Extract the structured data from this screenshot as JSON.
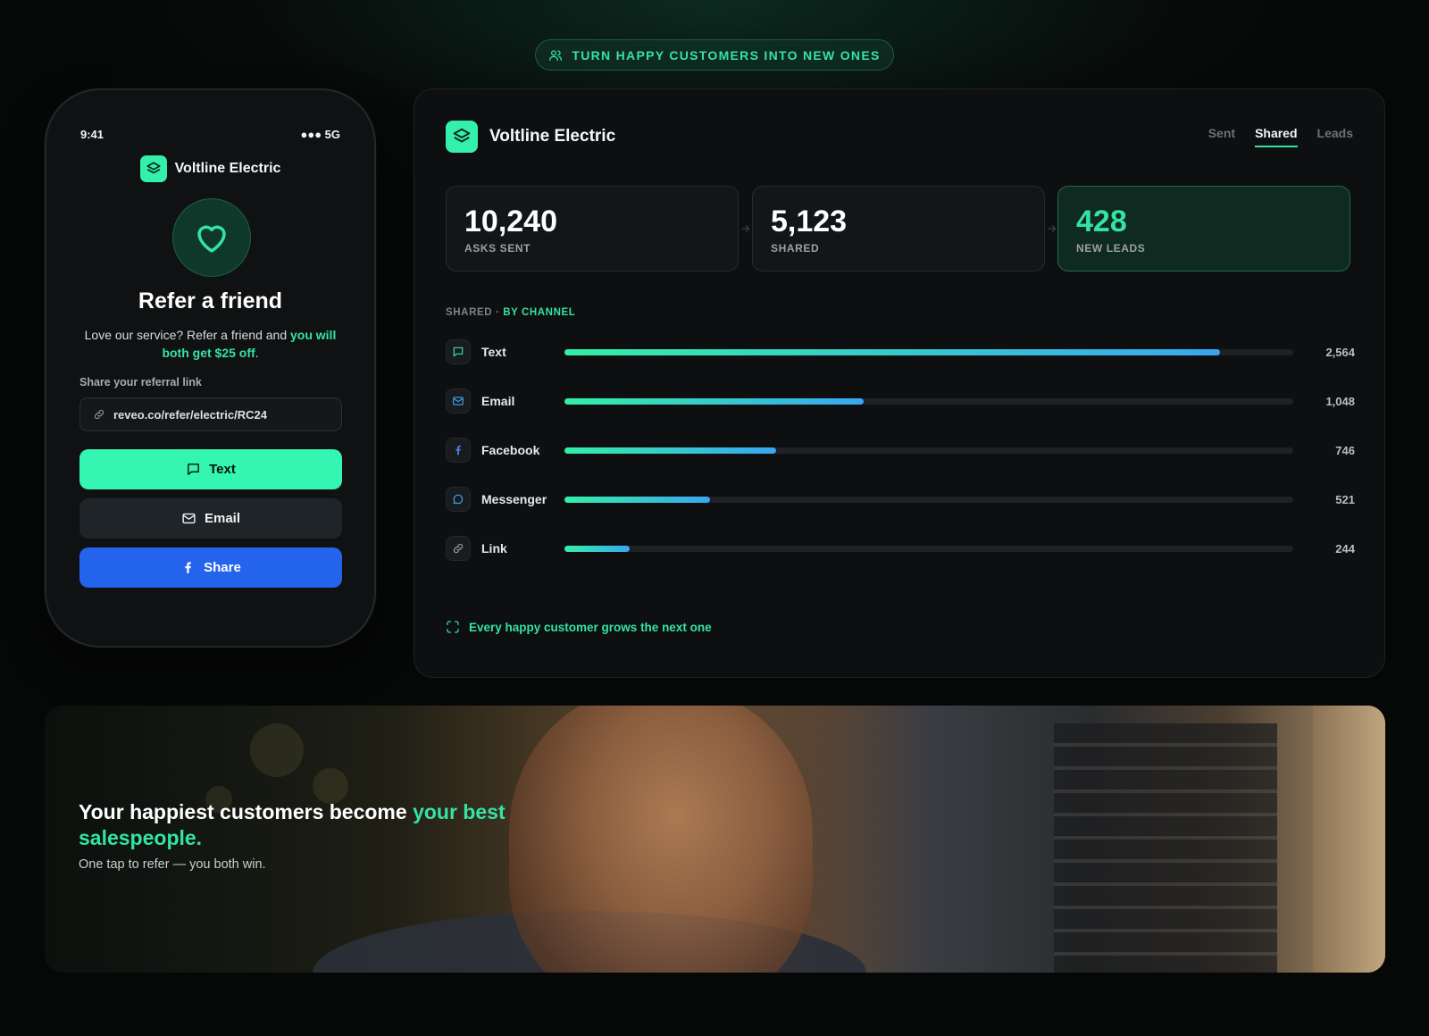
{
  "top_pill": {
    "label": "TURN HAPPY CUSTOMERS INTO NEW ONES",
    "icon": "users-icon"
  },
  "phone": {
    "time": "9:41",
    "signal": "●●● 5G",
    "brand": "Voltline Electric",
    "title": "Refer a friend",
    "desc_plain": "Love our service? Refer a friend and ",
    "desc_highlight": "you will both get $25 off",
    "desc_end": ".",
    "link_label": "Share your referral link",
    "link_value": "reveo.co/refer/electric/RC24",
    "buttons": {
      "text": "Text",
      "email": "Email",
      "share": "Share"
    }
  },
  "dashboard": {
    "brand": "Voltline Electric",
    "tabs": [
      {
        "label": "Sent",
        "active": false
      },
      {
        "label": "Shared",
        "active": true
      },
      {
        "label": "Leads",
        "active": false
      }
    ],
    "stats": [
      {
        "value": "10,240",
        "label": "ASKS SENT"
      },
      {
        "value": "5,123",
        "label": "SHARED"
      },
      {
        "value": "428",
        "label": "NEW LEADS"
      }
    ],
    "section": {
      "prefix": "SHARED",
      "separator": " · ",
      "accent": "BY CHANNEL"
    },
    "channels": [
      {
        "name": "Text",
        "value": "2,564",
        "share": 0.9,
        "icon": "message-square-icon"
      },
      {
        "name": "Email",
        "value": "1,048",
        "share": 0.41,
        "icon": "mail-icon"
      },
      {
        "name": "Facebook",
        "value": "746",
        "share": 0.29,
        "icon": "facebook-icon"
      },
      {
        "name": "Messenger",
        "value": "521",
        "share": 0.2,
        "icon": "message-circle-icon"
      },
      {
        "name": "Link",
        "value": "244",
        "share": 0.09,
        "icon": "link-icon"
      }
    ],
    "footer_note": "Every happy customer grows the next one"
  },
  "hero": {
    "title_plain": "Your happiest customers become ",
    "title_highlight": "your best salespeople.",
    "subtitle": "One tap to refer — you both win."
  },
  "colors": {
    "accent": "#34e3a4",
    "facebook_blue": "#2463eb",
    "bar_start": "#34efa6",
    "bar_end": "#3aa6f0"
  }
}
